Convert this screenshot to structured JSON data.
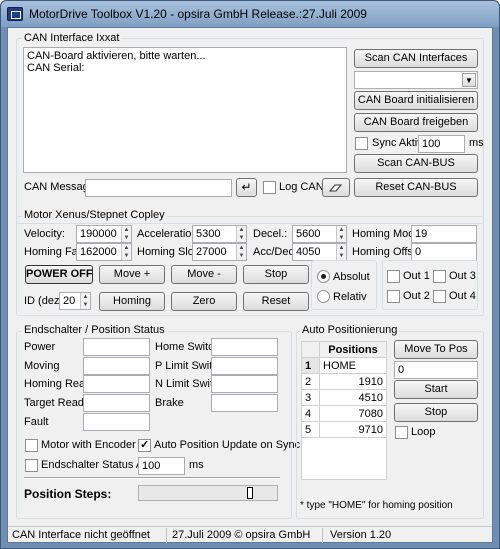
{
  "window": {
    "title": "MotorDrive Toolbox  V1.20 - opsira GmbH  Release.:27.Juli 2009"
  },
  "can": {
    "group_label": "CAN Interface Ixxat",
    "log_lines": [
      "CAN-Board aktivieren, bitte warten...",
      "CAN Serial:"
    ],
    "scan_button": "Scan CAN Interfaces",
    "combo_value": "",
    "init_button": "CAN Board initialisieren",
    "release_button": "CAN Board freigeben",
    "sync_label": "Sync Aktiv",
    "sync_value": "100",
    "sync_unit": "ms",
    "scan_bus_button": "Scan CAN-BUS",
    "message_label": "CAN Message:",
    "message_value": "",
    "enter_icon": "↵",
    "log_can_label": "Log CAN",
    "reset_bus_button": "Reset CAN-BUS"
  },
  "motor": {
    "group_label": "Motor Xenus/Stepnet Copley",
    "velocity_label": "Velocity:",
    "velocity_value": "190000",
    "accel_label": "Acceleration:",
    "accel_value": "5300",
    "decel_label": "Decel.:",
    "decel_value": "5600",
    "homing_mode_label": "Homing Mode:",
    "homing_mode_value": "19",
    "homing_fast_label": "Homing Fast:",
    "homing_fast_value": "162000",
    "homing_slow_label": "Homing Slow:",
    "homing_slow_value": "27000",
    "acc_dec_label": "Acc/Dec",
    "acc_dec_value": "4050",
    "homing_offset_label": "Homing Offset:",
    "homing_offset_value": "0",
    "power_off_button": "POWER OFF",
    "move_plus_button": "Move +",
    "move_minus_button": "Move -",
    "stop_button": "Stop",
    "absolut_label": "Absolut",
    "relativ_label": "Relativ",
    "out1": "Out 1",
    "out2": "Out 2",
    "out3": "Out 3",
    "out4": "Out 4",
    "id_label": "ID (dez.)",
    "id_value": "20",
    "homing_button": "Homing",
    "zero_button": "Zero",
    "reset_button": "Reset"
  },
  "status": {
    "group_label": "Endschalter / Position Status",
    "power_label": "Power",
    "moving_label": "Moving",
    "homing_ready_label": "Homing Ready",
    "target_ready_label": "Target Ready",
    "fault_label": "Fault",
    "home_switch_label": "Home Switch",
    "p_limit_label": "P Limit Switch",
    "n_limit_label": "N Limit Switch",
    "brake_label": "Brake",
    "motor_encoder_label": "Motor with Encoder",
    "auto_update_label": "Auto Position Update on Sync",
    "endschalter_label": "Endschalter Status Aktiv",
    "endschalter_value": "100",
    "endschalter_unit": "ms",
    "position_steps_label": "Position Steps:"
  },
  "auto": {
    "group_label": "Auto Positionierung",
    "column_header": "Positions",
    "rows": [
      {
        "num": "1",
        "pos": "HOME"
      },
      {
        "num": "2",
        "pos": "1910"
      },
      {
        "num": "3",
        "pos": "4510"
      },
      {
        "num": "4",
        "pos": "7080"
      },
      {
        "num": "5",
        "pos": "9710"
      }
    ],
    "move_to_pos_button": "Move To Pos",
    "target_value": "0",
    "start_button": "Start",
    "stop_button": "Stop",
    "loop_label": "Loop",
    "hint": "* type \"HOME\" for homing position"
  },
  "statusbar": {
    "left": "CAN Interface nicht geöffnet",
    "center": "27.Juli 2009 © opsira GmbH",
    "right": "Version 1.20"
  }
}
